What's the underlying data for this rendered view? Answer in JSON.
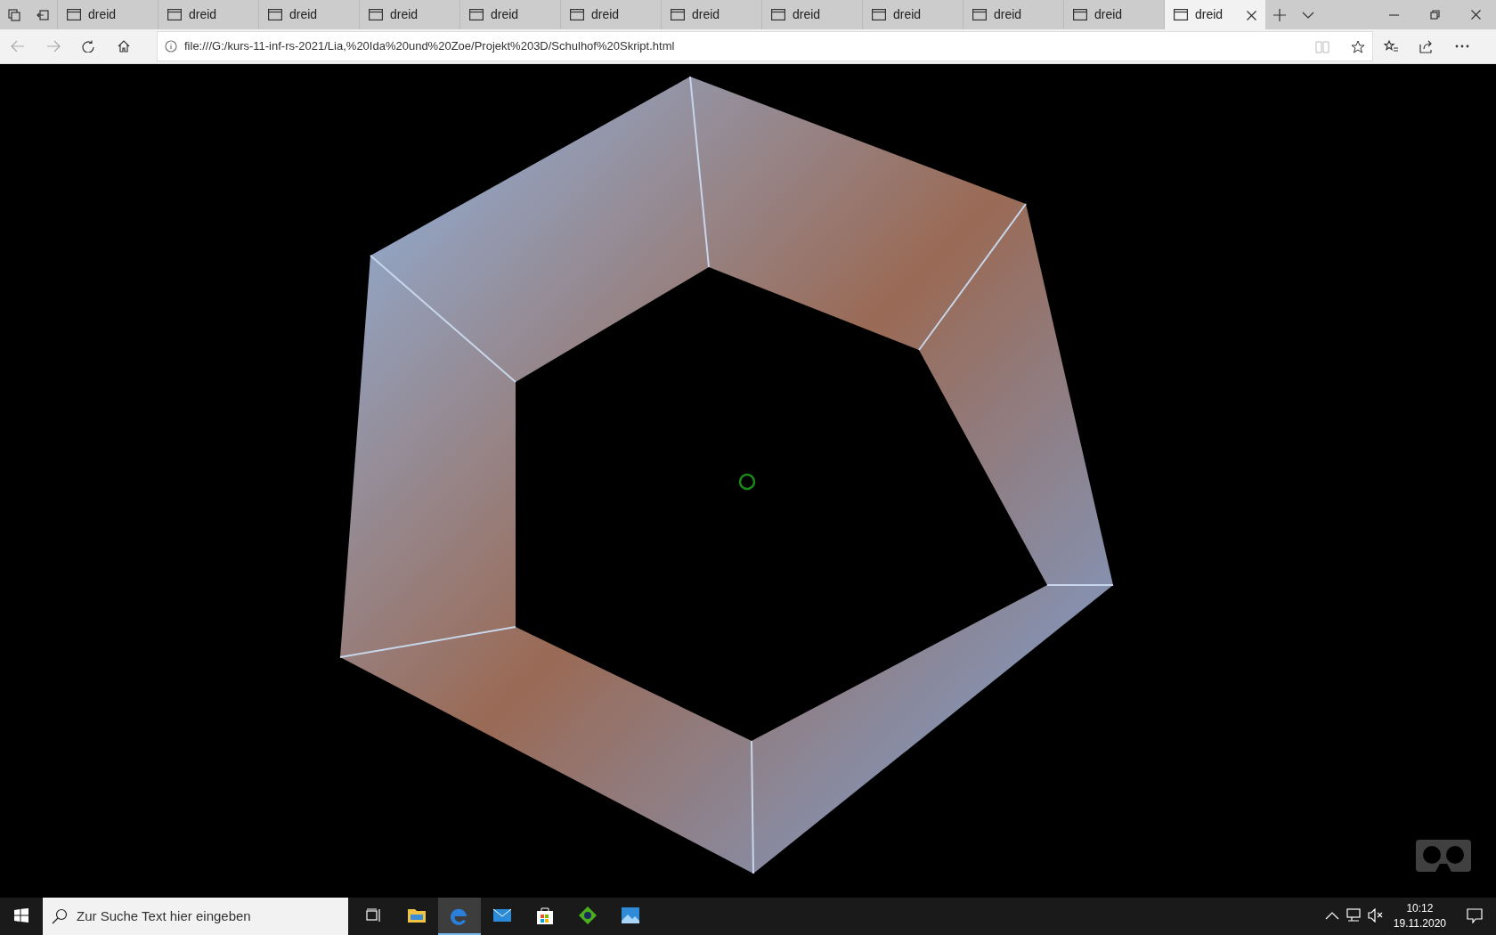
{
  "tabs": [
    {
      "label": "dreid",
      "selected": false
    },
    {
      "label": "dreid",
      "selected": false
    },
    {
      "label": "dreid",
      "selected": false
    },
    {
      "label": "dreid",
      "selected": false
    },
    {
      "label": "dreid",
      "selected": false
    },
    {
      "label": "dreid",
      "selected": false
    },
    {
      "label": "dreid",
      "selected": false
    },
    {
      "label": "dreid",
      "selected": false
    },
    {
      "label": "dreid",
      "selected": false
    },
    {
      "label": "dreid",
      "selected": false
    },
    {
      "label": "dreid",
      "selected": false
    },
    {
      "label": "dreid",
      "selected": true
    }
  ],
  "address_bar": {
    "url": "file:///G:/kurs-11-inf-rs-2021/Lia,%20Ida%20und%20Zoe/Projekt%203D/Schulhof%20Skript.html"
  },
  "taskbar": {
    "search": {
      "placeholder": "Zur Suche Text hier eingeben"
    },
    "apps": [
      {
        "kind": "explorer",
        "selected": false
      },
      {
        "kind": "edge",
        "selected": true
      },
      {
        "kind": "mail",
        "selected": false
      },
      {
        "kind": "store",
        "selected": false
      },
      {
        "kind": "game",
        "selected": false
      },
      {
        "kind": "photos",
        "selected": false
      }
    ],
    "clock": {
      "time": "10:12",
      "date": "19.11.2020"
    }
  }
}
